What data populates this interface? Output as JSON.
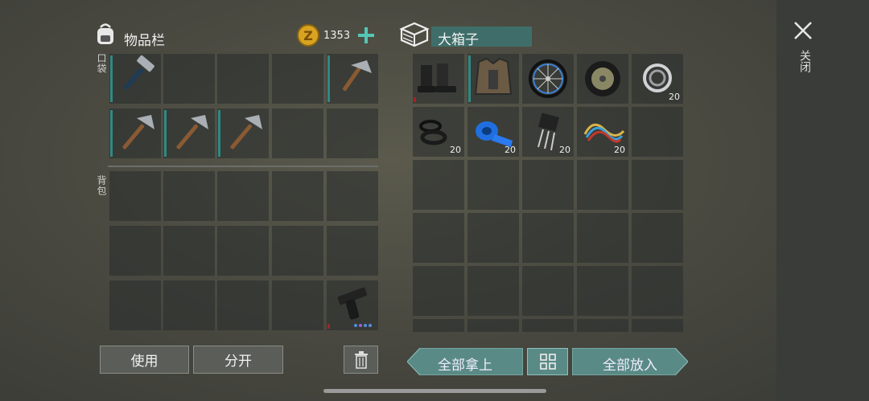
{
  "inventory": {
    "title": "物品栏",
    "coins": "1353",
    "pocket_label": "口袋",
    "backpack_label": "背包",
    "use_label": "使用",
    "split_label": "分开"
  },
  "container": {
    "title": "大箱子",
    "take_all_label": "全部拿上",
    "put_all_label": "全部放入",
    "items": [
      {
        "icon": "boots-icon",
        "qty": ""
      },
      {
        "icon": "armor-vest-icon",
        "qty": ""
      },
      {
        "icon": "bicycle-wheel-icon",
        "qty": ""
      },
      {
        "icon": "tire-icon",
        "qty": ""
      },
      {
        "icon": "ball-bearing-icon",
        "qty": "20"
      },
      {
        "icon": "rubber-rings-icon",
        "qty": "20"
      },
      {
        "icon": "duct-tape-icon",
        "qty": "20"
      },
      {
        "icon": "transistor-icon",
        "qty": "20"
      },
      {
        "icon": "wires-icon",
        "qty": "20"
      }
    ]
  },
  "close_label": "关闭"
}
